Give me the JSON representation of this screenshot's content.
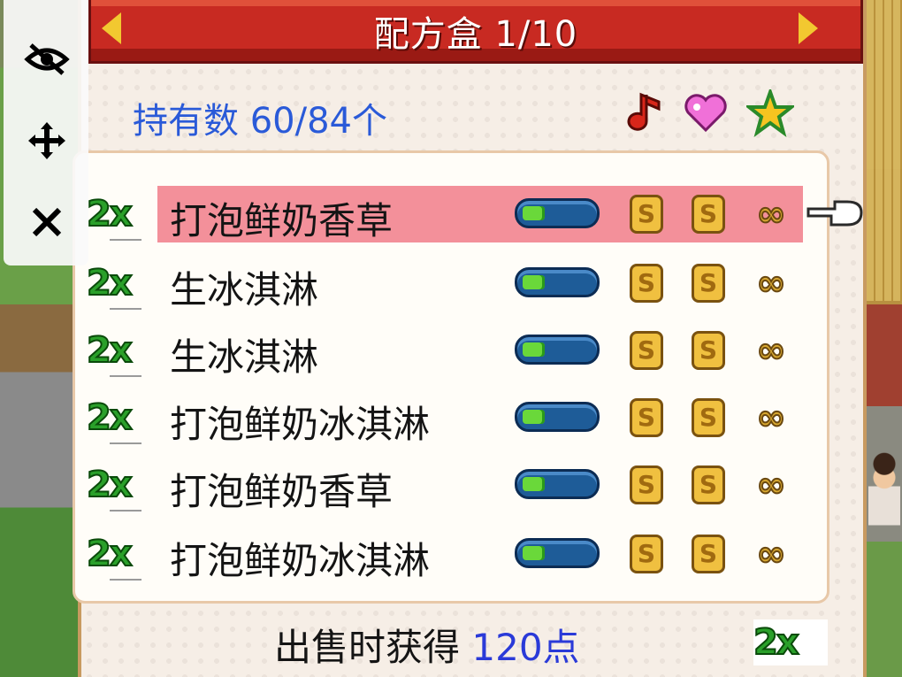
{
  "title": {
    "text": "配方盒 1/10"
  },
  "holdings": {
    "label": "持有数",
    "value": "60/84个"
  },
  "header_icons": [
    "music-note-icon",
    "heart-icon",
    "star-icon"
  ],
  "recipes": [
    {
      "multiplier": "2x",
      "name": "打泡鲜奶香草",
      "meter_fill": 0.3,
      "coin1": "S",
      "coin2": "S",
      "quantity": "∞",
      "selected": true
    },
    {
      "multiplier": "2x",
      "name": "生冰淇淋",
      "meter_fill": 0.3,
      "coin1": "S",
      "coin2": "S",
      "quantity": "∞",
      "selected": false
    },
    {
      "multiplier": "2x",
      "name": "生冰淇淋",
      "meter_fill": 0.3,
      "coin1": "S",
      "coin2": "S",
      "quantity": "∞",
      "selected": false
    },
    {
      "multiplier": "2x",
      "name": "打泡鲜奶冰淇淋",
      "meter_fill": 0.3,
      "coin1": "S",
      "coin2": "S",
      "quantity": "∞",
      "selected": false
    },
    {
      "multiplier": "2x",
      "name": "打泡鲜奶香草",
      "meter_fill": 0.3,
      "coin1": "S",
      "coin2": "S",
      "quantity": "∞",
      "selected": false
    },
    {
      "multiplier": "2x",
      "name": "打泡鲜奶冰淇淋",
      "meter_fill": 0.3,
      "coin1": "S",
      "coin2": "S",
      "quantity": "∞",
      "selected": false
    }
  ],
  "footer": {
    "label": "出售时获得",
    "points": "120点",
    "multiplier": "2x"
  },
  "toolbar": [
    "eye-off-icon",
    "move-icon",
    "close-icon"
  ],
  "colors": {
    "title_bar": "#c82a22",
    "highlight": "#f3909a",
    "accent_blue": "#2a5ad8",
    "badge_green": "#2aa02a"
  }
}
